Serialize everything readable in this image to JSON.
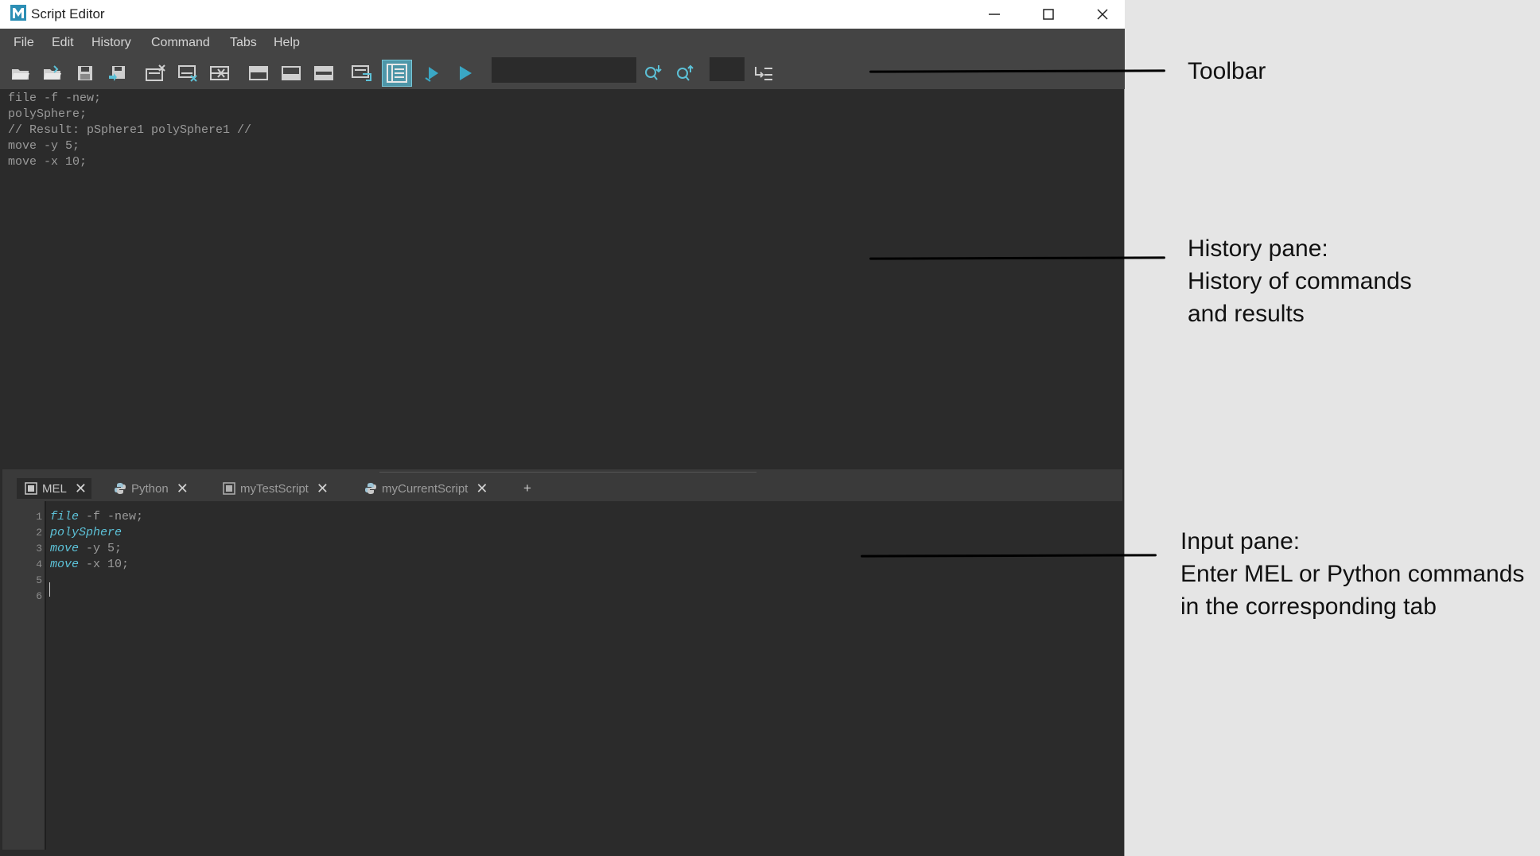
{
  "window": {
    "title": "Script Editor",
    "icon": "maya-m-icon"
  },
  "menu": [
    "File",
    "Edit",
    "History",
    "Command",
    "Tabs",
    "Help"
  ],
  "history_lines": [
    "file -f -new;",
    "polySphere;",
    "// Result: pSphere1 polySphere1 //",
    "move -y 5;",
    "move -x 10;"
  ],
  "tabs": [
    {
      "label": "MEL",
      "icon": "mel-script-icon",
      "selected": true
    },
    {
      "label": "Python",
      "icon": "python-icon",
      "selected": false
    },
    {
      "label": "myTestScript",
      "icon": "mel-script-icon",
      "selected": false
    },
    {
      "label": "myCurrentScript",
      "icon": "python-icon",
      "selected": false
    }
  ],
  "tab_add_label": "+",
  "code_lines": [
    {
      "n": "1",
      "kw": "file",
      "rest": " -f -new;"
    },
    {
      "n": "2",
      "kw": "polySphere",
      "rest": ""
    },
    {
      "n": "3",
      "kw": "move",
      "rest": " -y 5;"
    },
    {
      "n": "4",
      "kw": "move",
      "rest": " -x 10;"
    },
    {
      "n": "5",
      "kw": "",
      "rest": ""
    },
    {
      "n": "6",
      "kw": "",
      "rest": ""
    }
  ],
  "annotations": {
    "toolbar": [
      "Toolbar"
    ],
    "history": [
      "History pane:",
      "History of commands",
      "and results"
    ],
    "input": [
      "Input pane:",
      "Enter MEL or Python commands",
      "in the corresponding tab"
    ]
  },
  "colors": {
    "accent": "#5cc1d7",
    "panel": "#2b2b2b",
    "chrome": "#444444",
    "active_button": "#4e96a8"
  }
}
